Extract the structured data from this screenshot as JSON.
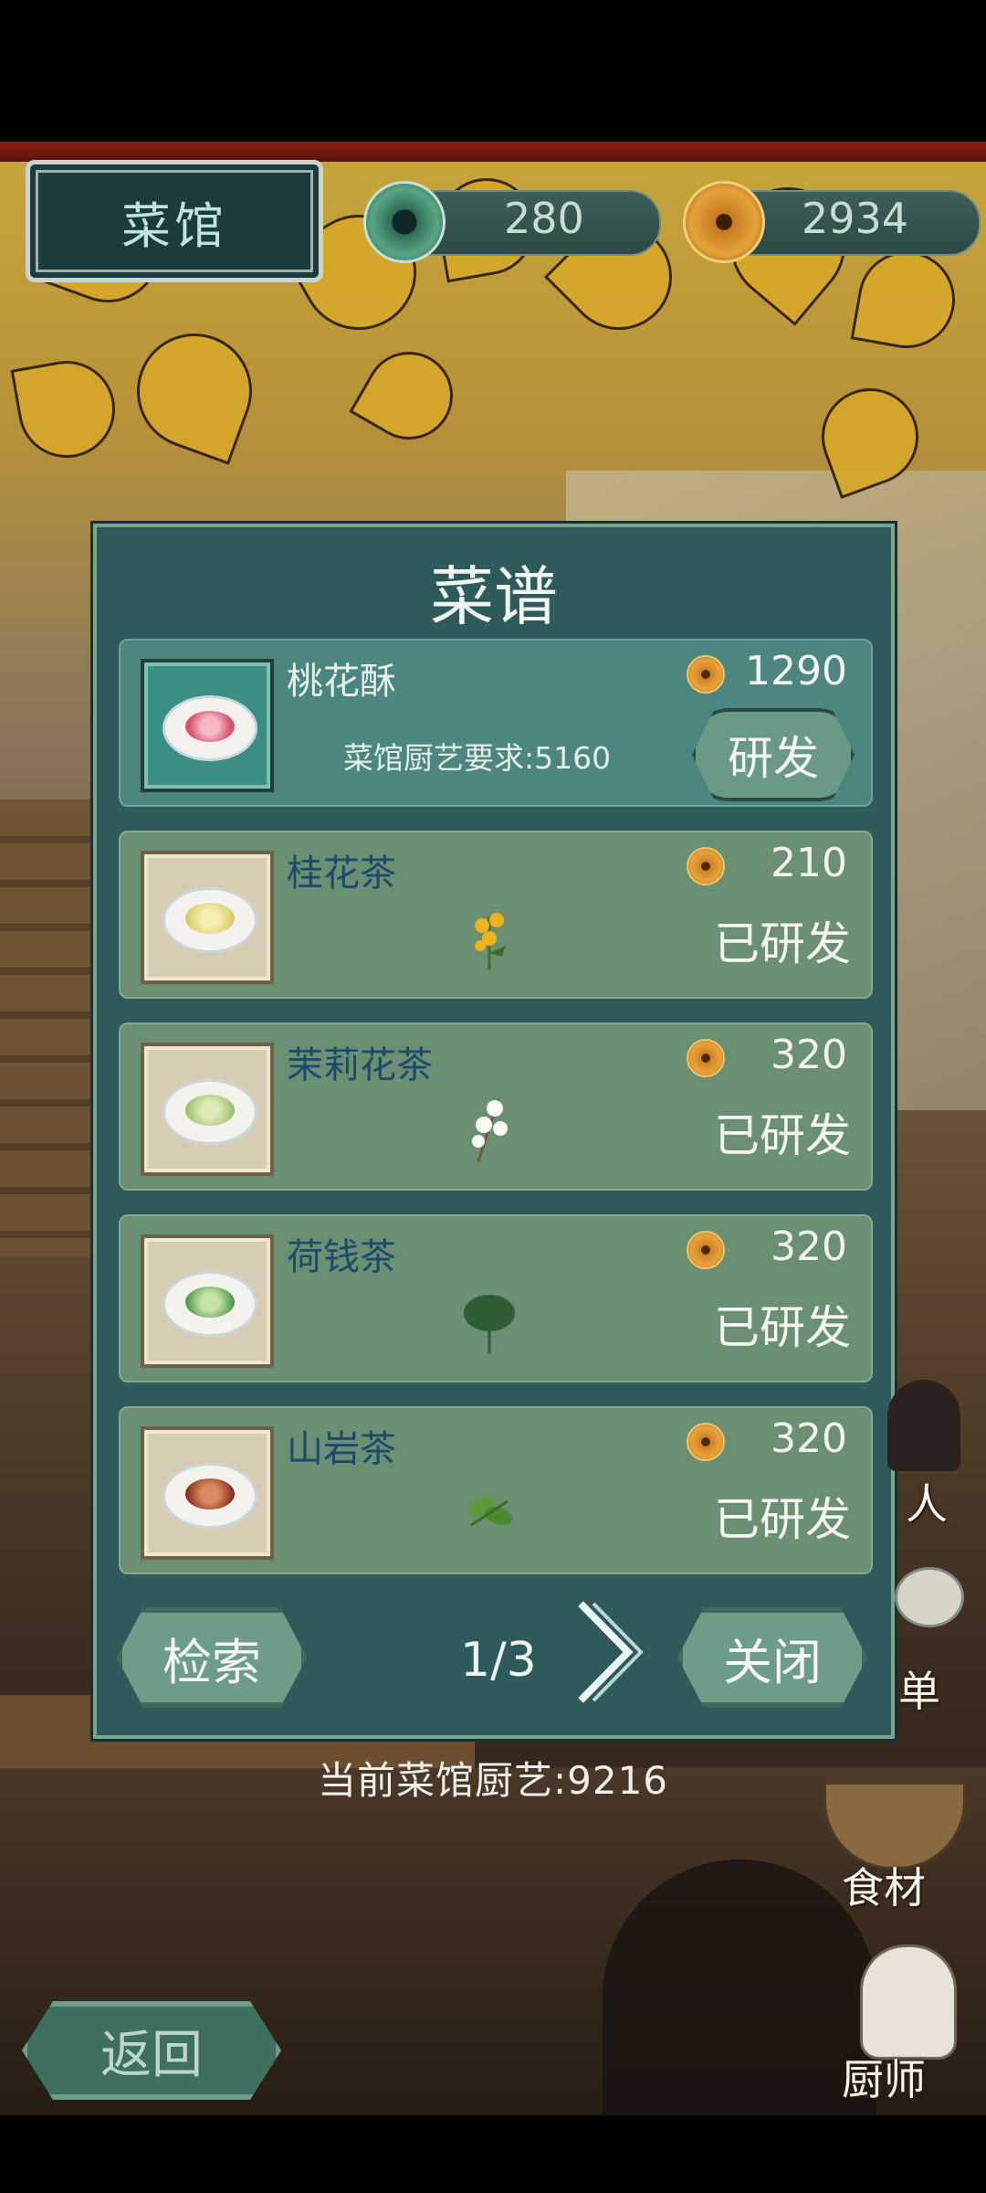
{
  "header": {
    "title": "菜馆",
    "jade_value": "280",
    "coin_value": "2934"
  },
  "panel": {
    "title": "菜谱",
    "recipes": [
      {
        "name": "桃花酥",
        "price": "1290",
        "requirement": "菜馆厨艺要求:5160",
        "action": "研发",
        "state": "locked"
      },
      {
        "name": "桂花茶",
        "price": "210",
        "status": "已研发",
        "state": "done"
      },
      {
        "name": "茉莉花茶",
        "price": "320",
        "status": "已研发",
        "state": "done"
      },
      {
        "name": "荷钱茶",
        "price": "320",
        "status": "已研发",
        "state": "done"
      },
      {
        "name": "山岩茶",
        "price": "320",
        "status": "已研发",
        "state": "done"
      }
    ],
    "search_label": "检索",
    "page": "1/3",
    "close_label": "关闭"
  },
  "current_skill": "当前菜馆厨艺:9216",
  "back_label": "返回",
  "side_menu": {
    "ren": "人",
    "dan": "单",
    "ingredients": "食材",
    "chef": "厨师"
  }
}
